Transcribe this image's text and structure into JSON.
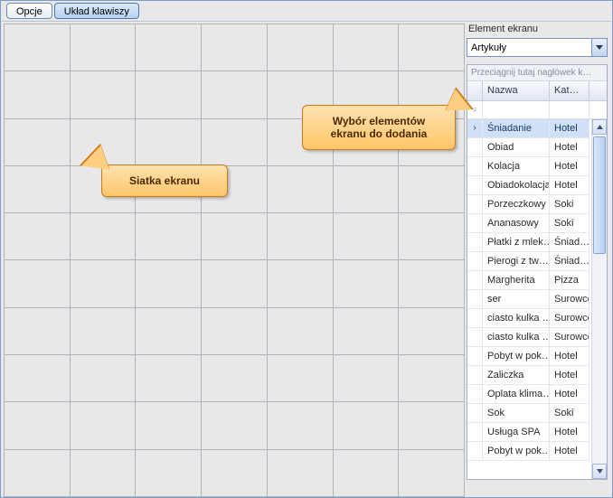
{
  "tabs": {
    "options": "Opcje",
    "layout": "Układ klawiszy"
  },
  "side": {
    "label": "Element ekranu",
    "combo_value": "Artykuły",
    "group_hint": "Przeciągnij tutaj nagłówek k…",
    "columns": {
      "name": "Nazwa",
      "cat": "Kat…"
    }
  },
  "rows": [
    {
      "name": "Śniadanie",
      "cat": "Hotel",
      "selected": true
    },
    {
      "name": "Obiad",
      "cat": "Hotel"
    },
    {
      "name": "Kolacja",
      "cat": "Hotel"
    },
    {
      "name": "Obiadokolacja",
      "cat": "Hotel"
    },
    {
      "name": "Porzeczkowy",
      "cat": "Soki"
    },
    {
      "name": "Ananasowy",
      "cat": "Soki"
    },
    {
      "name": "Płatki z mlek…",
      "cat": "Śniad…"
    },
    {
      "name": "Pierogi z tw…",
      "cat": "Śniad…"
    },
    {
      "name": "Margherita",
      "cat": "Pizza"
    },
    {
      "name": "ser",
      "cat": "Surowce"
    },
    {
      "name": "ciasto kulka …",
      "cat": "Surowce"
    },
    {
      "name": "ciasto kulka …",
      "cat": "Surowce"
    },
    {
      "name": "Pobyt w pok…",
      "cat": "Hotel"
    },
    {
      "name": "Zaliczka",
      "cat": "Hotel"
    },
    {
      "name": "Oplata klima…",
      "cat": "Hotel"
    },
    {
      "name": "Sok",
      "cat": "Soki"
    },
    {
      "name": "Usługa SPA",
      "cat": "Hotel"
    },
    {
      "name": "Pobyt w pok…",
      "cat": "Hotel"
    }
  ],
  "callouts": {
    "grid": "Siatka ekranu",
    "picker": "Wybór elementów ekranu do dodania"
  },
  "icons": {
    "filter": "♀"
  }
}
